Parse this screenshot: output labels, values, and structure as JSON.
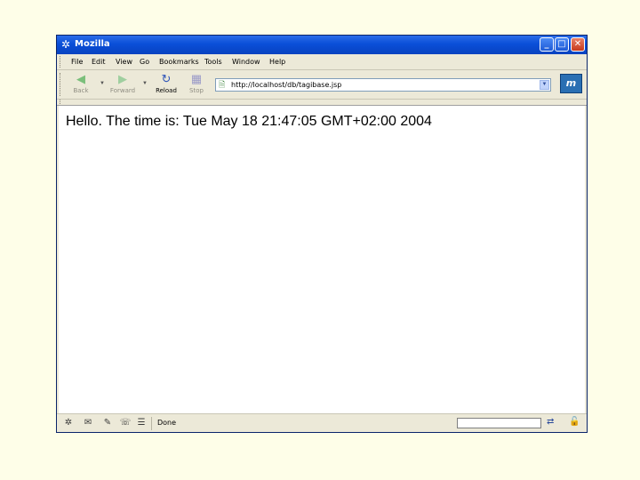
{
  "window": {
    "title": "Mozilla"
  },
  "menu": {
    "items": [
      "File",
      "Edit",
      "View",
      "Go",
      "Bookmarks",
      "Tools",
      "Window",
      "Help"
    ]
  },
  "toolbar": {
    "back_label": "Back",
    "forward_label": "Forward",
    "reload_label": "Reload",
    "stop_label": "Stop",
    "url": "http://localhost/db/tagibase.jsp"
  },
  "content": {
    "text": "Hello. The time is: Tue May 18 21:47:05 GMT+02:00 2004"
  },
  "status": {
    "text": "Done"
  },
  "icons": {
    "app": "mozilla-icon",
    "back": "back-arrow-icon",
    "forward": "forward-arrow-icon",
    "reload": "reload-icon",
    "stop": "stop-icon",
    "page": "page-icon",
    "throbber": "mozilla-throbber-icon"
  },
  "colors": {
    "titlebar": "#0a4fd8",
    "slide_background": "#fefee8",
    "chrome": "#ece9d8"
  }
}
